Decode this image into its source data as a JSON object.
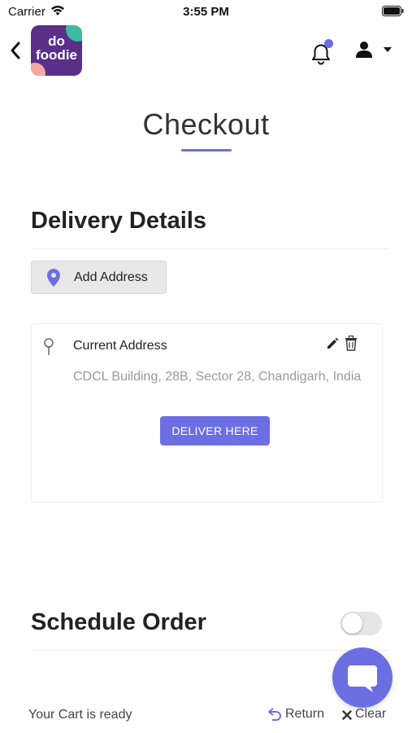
{
  "status_bar": {
    "carrier": "Carrier",
    "time": "3:55 PM",
    "icons": [
      "wifi-icon",
      "battery-icon"
    ]
  },
  "header": {
    "logo_text": "do\nfoodie",
    "icons": [
      "back-icon",
      "bell-icon",
      "user-icon",
      "caret-down-icon"
    ],
    "notification_dot": true
  },
  "page": {
    "title": "Checkout"
  },
  "delivery": {
    "heading": "Delivery Details",
    "add_address_label": "Add Address",
    "address_card": {
      "title": "Current Address",
      "address": "CDCL Building, 28B, Sector 28, Chandigarh, India",
      "deliver_button": "DELIVER HERE",
      "icons": [
        "map-pin-icon",
        "edit-icon",
        "trash-icon"
      ]
    }
  },
  "schedule": {
    "heading": "Schedule Order",
    "toggle_on": false
  },
  "footer": {
    "cart_status": "Your Cart is ready",
    "return_label": "Return",
    "clear_label": "Clear"
  },
  "colors": {
    "accent": "#6c6fe2",
    "logo_bg": "#5a2f87",
    "muted_text": "#9a9a9a",
    "button_gray": "#e8e8e8"
  }
}
